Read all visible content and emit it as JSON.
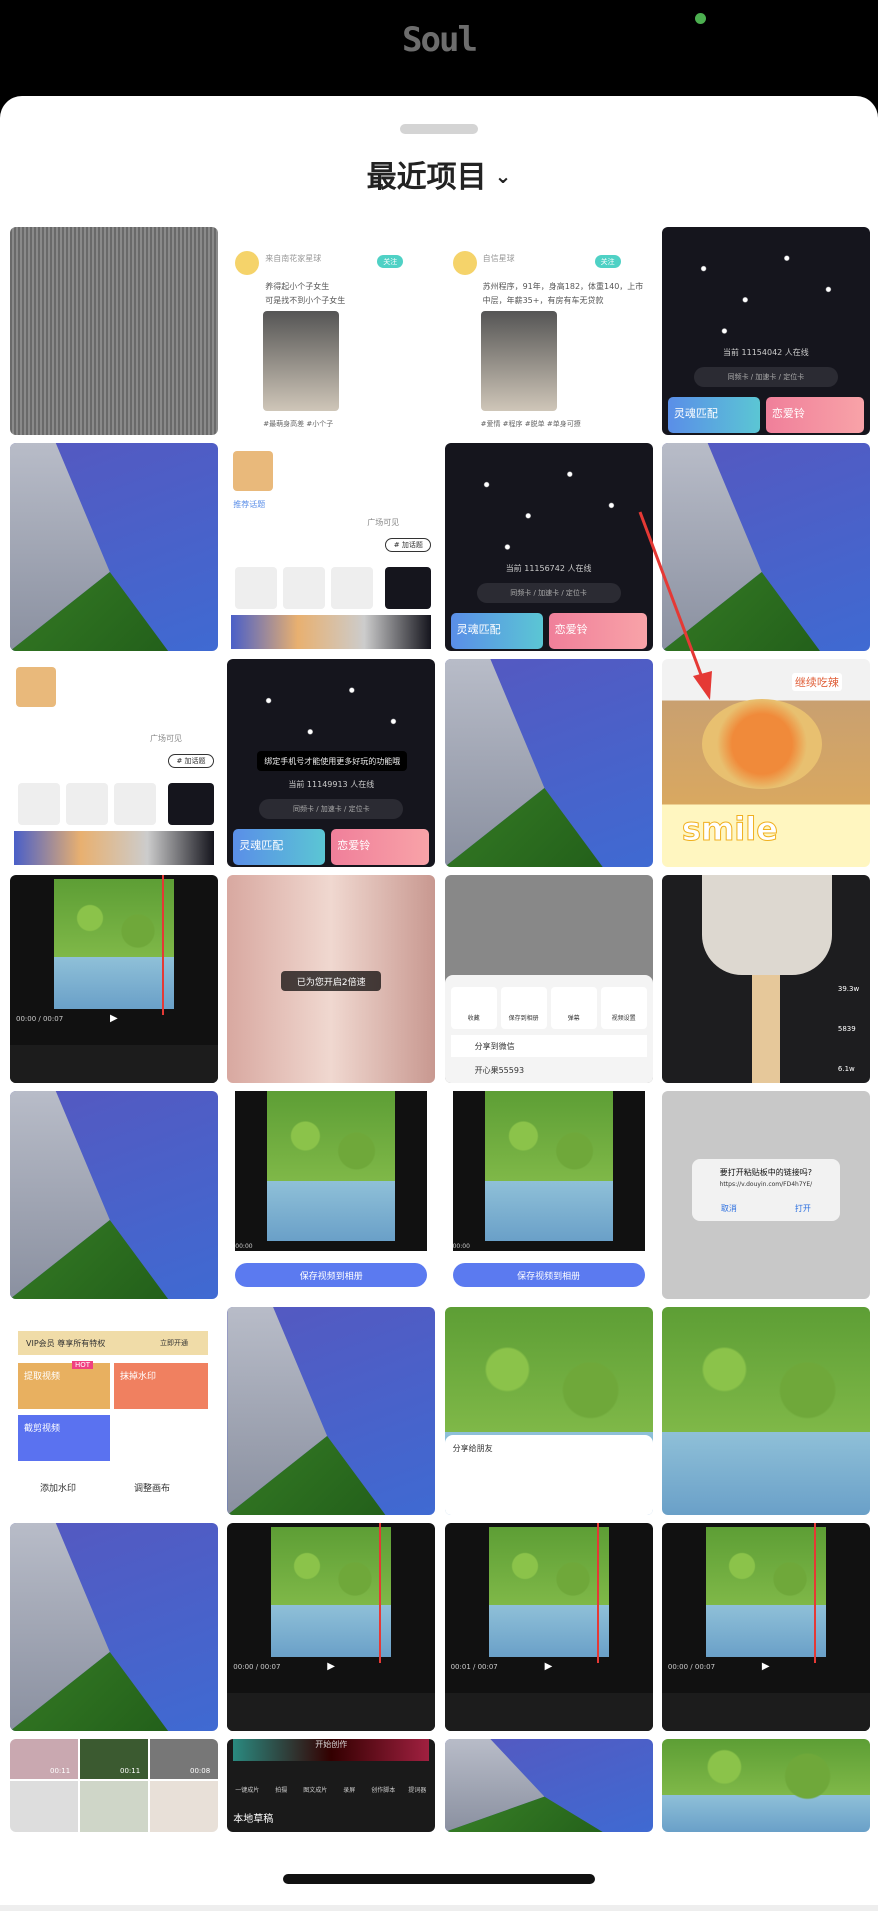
{
  "status_bar": {
    "app_logo": "Soul"
  },
  "header": {
    "title": "最近项目",
    "dropdown_icon": "chevron-down-icon"
  },
  "colors": {
    "accent_teal": "#4fd1c5",
    "soul_blue": "#5a8ee8",
    "soul_pink": "#f07f9a",
    "arrow": "#e53935"
  },
  "tiles": [
    {
      "type": "texture"
    },
    {
      "type": "post",
      "name": "来自南花家星球",
      "text1": "养得起小个子女生",
      "text2": "可是找不到小个子女生",
      "follow": "关注",
      "tags": [
        "#最萌身高差",
        "#小个子"
      ]
    },
    {
      "type": "post",
      "name": "自信星球",
      "text1": "苏州程序，91年，身高182，体重140，上市",
      "text2": "中层，年薪35+，有房有车无贷款",
      "follow": "关注",
      "tags": [
        "#爱情",
        "#程序",
        "#脱单",
        "#单身可撩"
      ]
    },
    {
      "type": "stars",
      "online": "当前 11154042 人在线",
      "cards": "同频卡 / 加速卡 / 定位卡",
      "match": "灵魂匹配",
      "love": "恋爱铃"
    },
    {
      "type": "wallpaper"
    },
    {
      "type": "compose",
      "topic": "推荐话题",
      "visibility": "广场可见",
      "add_topic": "# 加话题"
    },
    {
      "type": "stars",
      "online": "当前 11156742 人在线",
      "cards": "同频卡 / 加速卡 / 定位卡",
      "match": "灵魂匹配",
      "love": "恋爱铃"
    },
    {
      "type": "wallpaper"
    },
    {
      "type": "compose",
      "topic": "",
      "visibility": "广场可见",
      "add_topic": "# 加话题"
    },
    {
      "type": "stars",
      "toast": "绑定手机号才能使用更多好玩的功能哦",
      "online": "当前 11149913 人在线",
      "cards": "同频卡 / 加速卡 / 定位卡",
      "match": "灵魂匹配",
      "love": "恋爱铃"
    },
    {
      "type": "wallpaper"
    },
    {
      "type": "food",
      "caption": "smile",
      "sticker": "继续吃辣"
    },
    {
      "type": "editor",
      "time": "00:00 / 00:07"
    },
    {
      "type": "pink",
      "toast": "已为您开启2倍速"
    },
    {
      "type": "share",
      "actions": [
        "收藏",
        "保存到相册",
        "弹幕",
        "视频设置"
      ],
      "wechat": "分享到微信",
      "user": "开心果55593"
    },
    {
      "type": "pan",
      "likes": "39.3w",
      "comments": "5839",
      "stars": "6.1w"
    },
    {
      "type": "wallpaper"
    },
    {
      "type": "save",
      "time": "00:00",
      "button": "保存视频到相册"
    },
    {
      "type": "save",
      "time": "00:00",
      "button": "保存视频到相册"
    },
    {
      "type": "dialog",
      "question": "要打开粘贴板中的链接吗?",
      "url": "https://v.douyin.com/FD4h7YE/",
      "cancel": "取消",
      "open": "打开"
    },
    {
      "type": "vip",
      "vip": "VIP会员 尊享所有特权",
      "open": "立即开通",
      "extract": "提取视频",
      "hot": "HOT",
      "remove": "抹掉水印",
      "cut": "截剪视频",
      "add_wm": "添加水印",
      "canvas": "调整画布"
    },
    {
      "type": "wallpaper"
    },
    {
      "type": "treeshare",
      "title": "分享给朋友"
    },
    {
      "type": "tree"
    },
    {
      "type": "wallpaper"
    },
    {
      "type": "editor",
      "time": "00:00 / 00:07"
    },
    {
      "type": "editor",
      "time": "00:01 / 00:07"
    },
    {
      "type": "editor",
      "time": "00:00 / 00:07"
    },
    {
      "type": "collage",
      "durations": [
        "00:11",
        "00:11",
        "00:08"
      ]
    },
    {
      "type": "create",
      "title": "开始创作",
      "tools": [
        "一键成片",
        "拍摄",
        "图文成片",
        "录屏",
        "创作脚本",
        "提词器"
      ],
      "drafts": "本地草稿"
    },
    {
      "type": "wallpaper"
    },
    {
      "type": "tree"
    }
  ]
}
